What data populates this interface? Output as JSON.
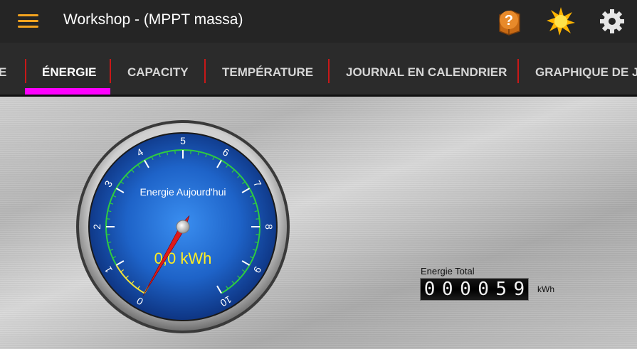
{
  "appbar": {
    "title": "Workshop - (MPPT massa)",
    "menu_icon": "hamburger-menu-icon",
    "help_icon": "help-book-icon",
    "sun_icon": "sun-icon",
    "settings_icon": "gear-icon"
  },
  "tabs": [
    {
      "label": "E",
      "active": false
    },
    {
      "label": "ÉNERGIE",
      "active": true
    },
    {
      "label": "CAPACITY",
      "active": false
    },
    {
      "label": "TEMPÉRATURE",
      "active": false
    },
    {
      "label": "JOURNAL EN CALENDRIER",
      "active": false
    },
    {
      "label": "GRAPHIQUE DE JO",
      "active": false
    }
  ],
  "gauge": {
    "title": "Energie Aujourd'hui",
    "readout": "0,0 kWh",
    "value": 0.0,
    "min": 0,
    "max": 10,
    "tick_labels": [
      "0",
      "1",
      "2",
      "3",
      "4",
      "5",
      "6",
      "7",
      "8",
      "9",
      "10"
    ],
    "colors": {
      "face": "#1e63c8",
      "scale": "#2ecc40",
      "low_band": "#f1e33a",
      "needle": "#e01a1a",
      "readout": "#ffee22"
    }
  },
  "total": {
    "label": "Energie Total",
    "digits": [
      "0",
      "0",
      "0",
      "0",
      "5",
      "9"
    ],
    "unit": "kWh"
  },
  "colors": {
    "accent_tab": "#ff00ff",
    "tab_separator": "#c81818",
    "menu": "#f2a31f"
  }
}
